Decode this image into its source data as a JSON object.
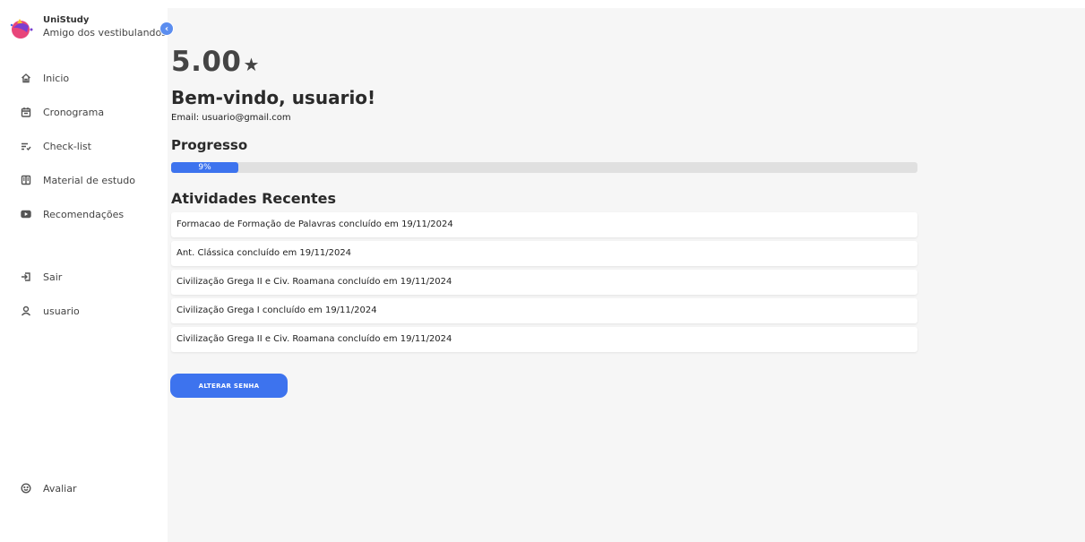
{
  "app": {
    "name": "UniStudy",
    "tagline": "Amigo dos vestibulandos"
  },
  "sidebar": {
    "collapse_glyph": "‹",
    "items": [
      {
        "label": "Inicio",
        "icon": "home-icon"
      },
      {
        "label": "Cronograma",
        "icon": "calendar-icon"
      },
      {
        "label": "Check-list",
        "icon": "checklist-icon"
      },
      {
        "label": "Material de estudo",
        "icon": "book-icon"
      },
      {
        "label": "Recomendações",
        "icon": "video-icon"
      },
      {
        "label": "Sair",
        "icon": "logout-icon"
      },
      {
        "label": "usuario",
        "icon": "user-icon"
      },
      {
        "label": "Avaliar",
        "icon": "smiley-icon"
      }
    ]
  },
  "main": {
    "rating": "5.00",
    "rating_star": "★",
    "welcome": "Bem-vindo, usuario!",
    "email": "Email: usuario@gmail.com",
    "progress_title": "Progresso",
    "progress_label": "9%",
    "progress_value": 9,
    "recent_title": "Atividades Recentes",
    "activities": [
      "Formacao de Formação de Palavras concluído em 19/11/2024",
      "Ant. Clássica concluído em 19/11/2024",
      "Civilização Grega II e Civ. Roamana concluído em 19/11/2024",
      "Civilização Grega I concluído em 19/11/2024",
      "Civilização Grega II e Civ. Roamana concluído em 19/11/2024"
    ],
    "change_password_label": "ALTERAR SENHA"
  },
  "colors": {
    "accent": "#3d73ee",
    "panel_bg": "#f6f6f6",
    "track": "#e0e0e0"
  }
}
